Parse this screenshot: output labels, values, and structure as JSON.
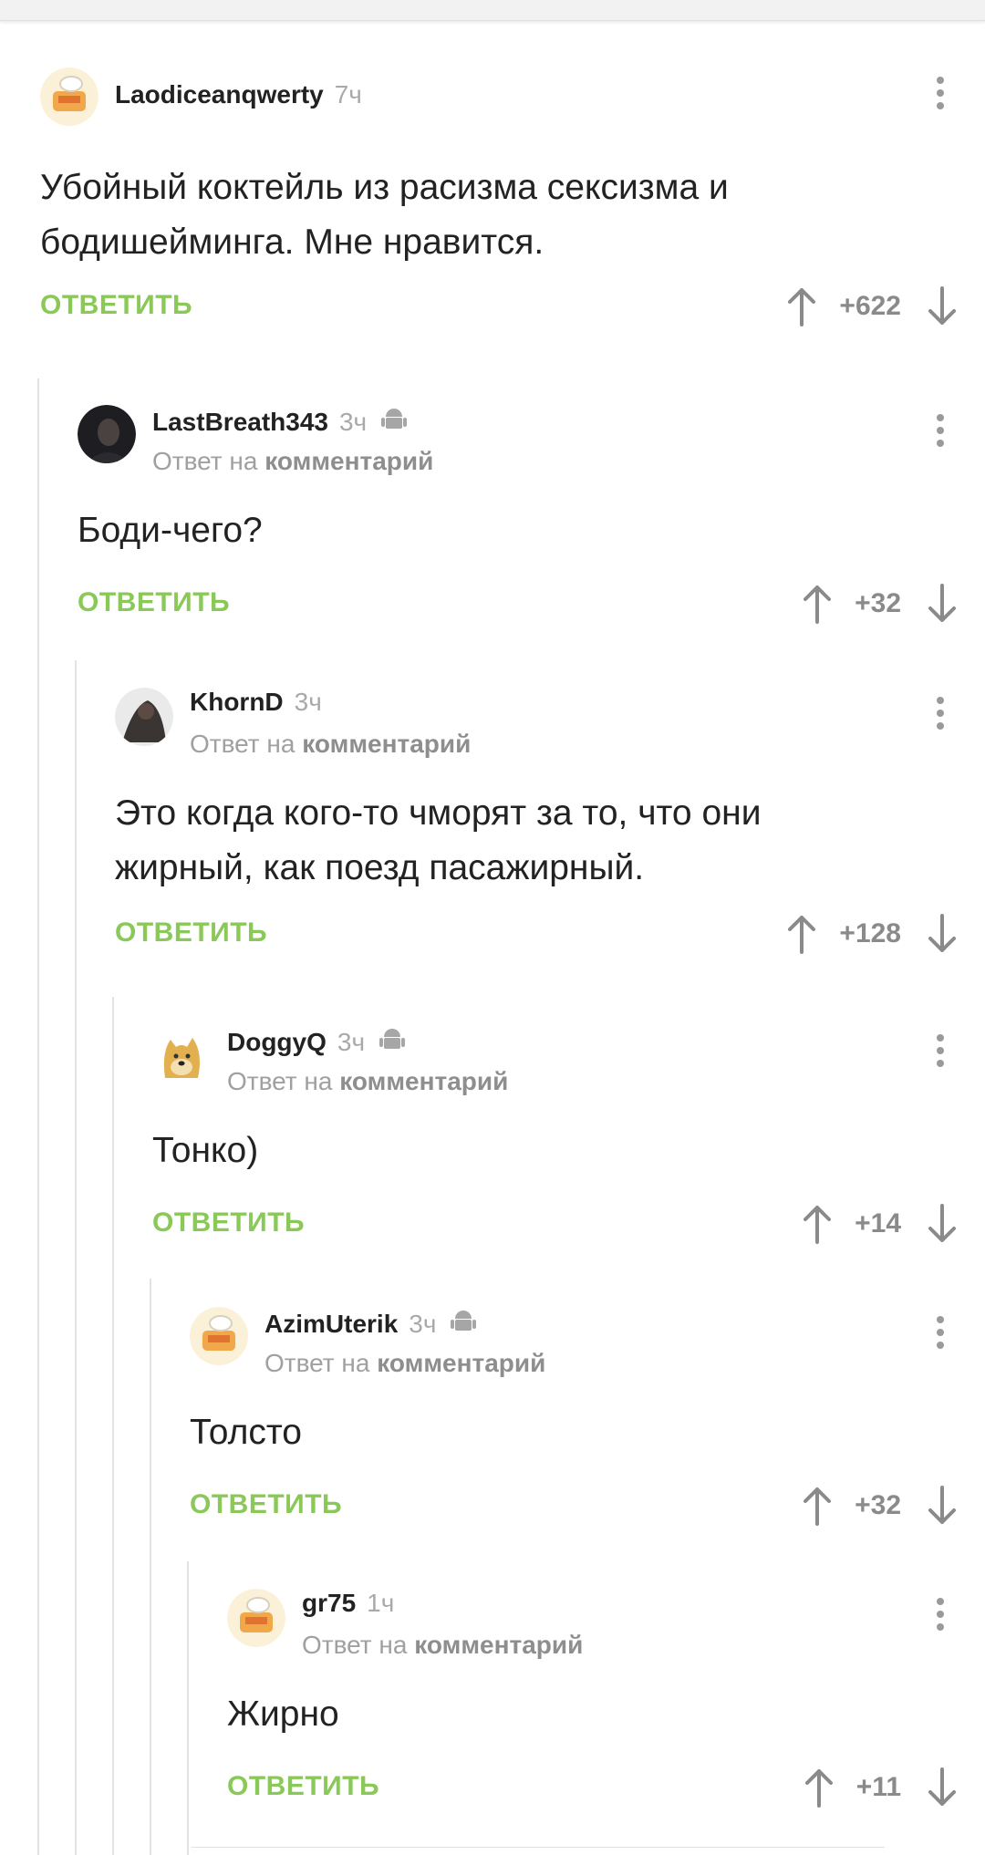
{
  "ui": {
    "reply_label": "ОТВЕТИТЬ",
    "reply_to_prefix": "Ответ на",
    "reply_to_link": "комментарий",
    "accent_color": "#8ac858",
    "icons": [
      "more-vertical-icon",
      "upvote-arrow-icon",
      "downvote-arrow-icon",
      "android-icon"
    ]
  },
  "comments": [
    {
      "user": "Laodiceanqwerty",
      "time": "7ч",
      "text": "Убойный коктейль из расизма сексизма и бодишейминга. Мне нравится.",
      "score": "+622",
      "is_reply": false
    },
    {
      "user": "LastBreath343",
      "time": "3ч",
      "text": "Боди-чего?",
      "score": "+32",
      "is_reply": true,
      "android": true
    },
    {
      "user": "KhornD",
      "time": "3ч",
      "text": "Это когда кого-то чморят за то, что они жирный, как поезд пасажирный.",
      "score": "+128",
      "is_reply": true
    },
    {
      "user": "DoggyQ",
      "time": "3ч",
      "text": "Тонко)",
      "score": "+14",
      "is_reply": true,
      "android": true
    },
    {
      "user": "AzimUterik",
      "time": "3ч",
      "text": "Толсто",
      "score": "+32",
      "is_reply": true,
      "android": true
    },
    {
      "user": "gr75",
      "time": "1ч",
      "text": "Жирно",
      "score": "+11",
      "is_reply": true
    }
  ]
}
